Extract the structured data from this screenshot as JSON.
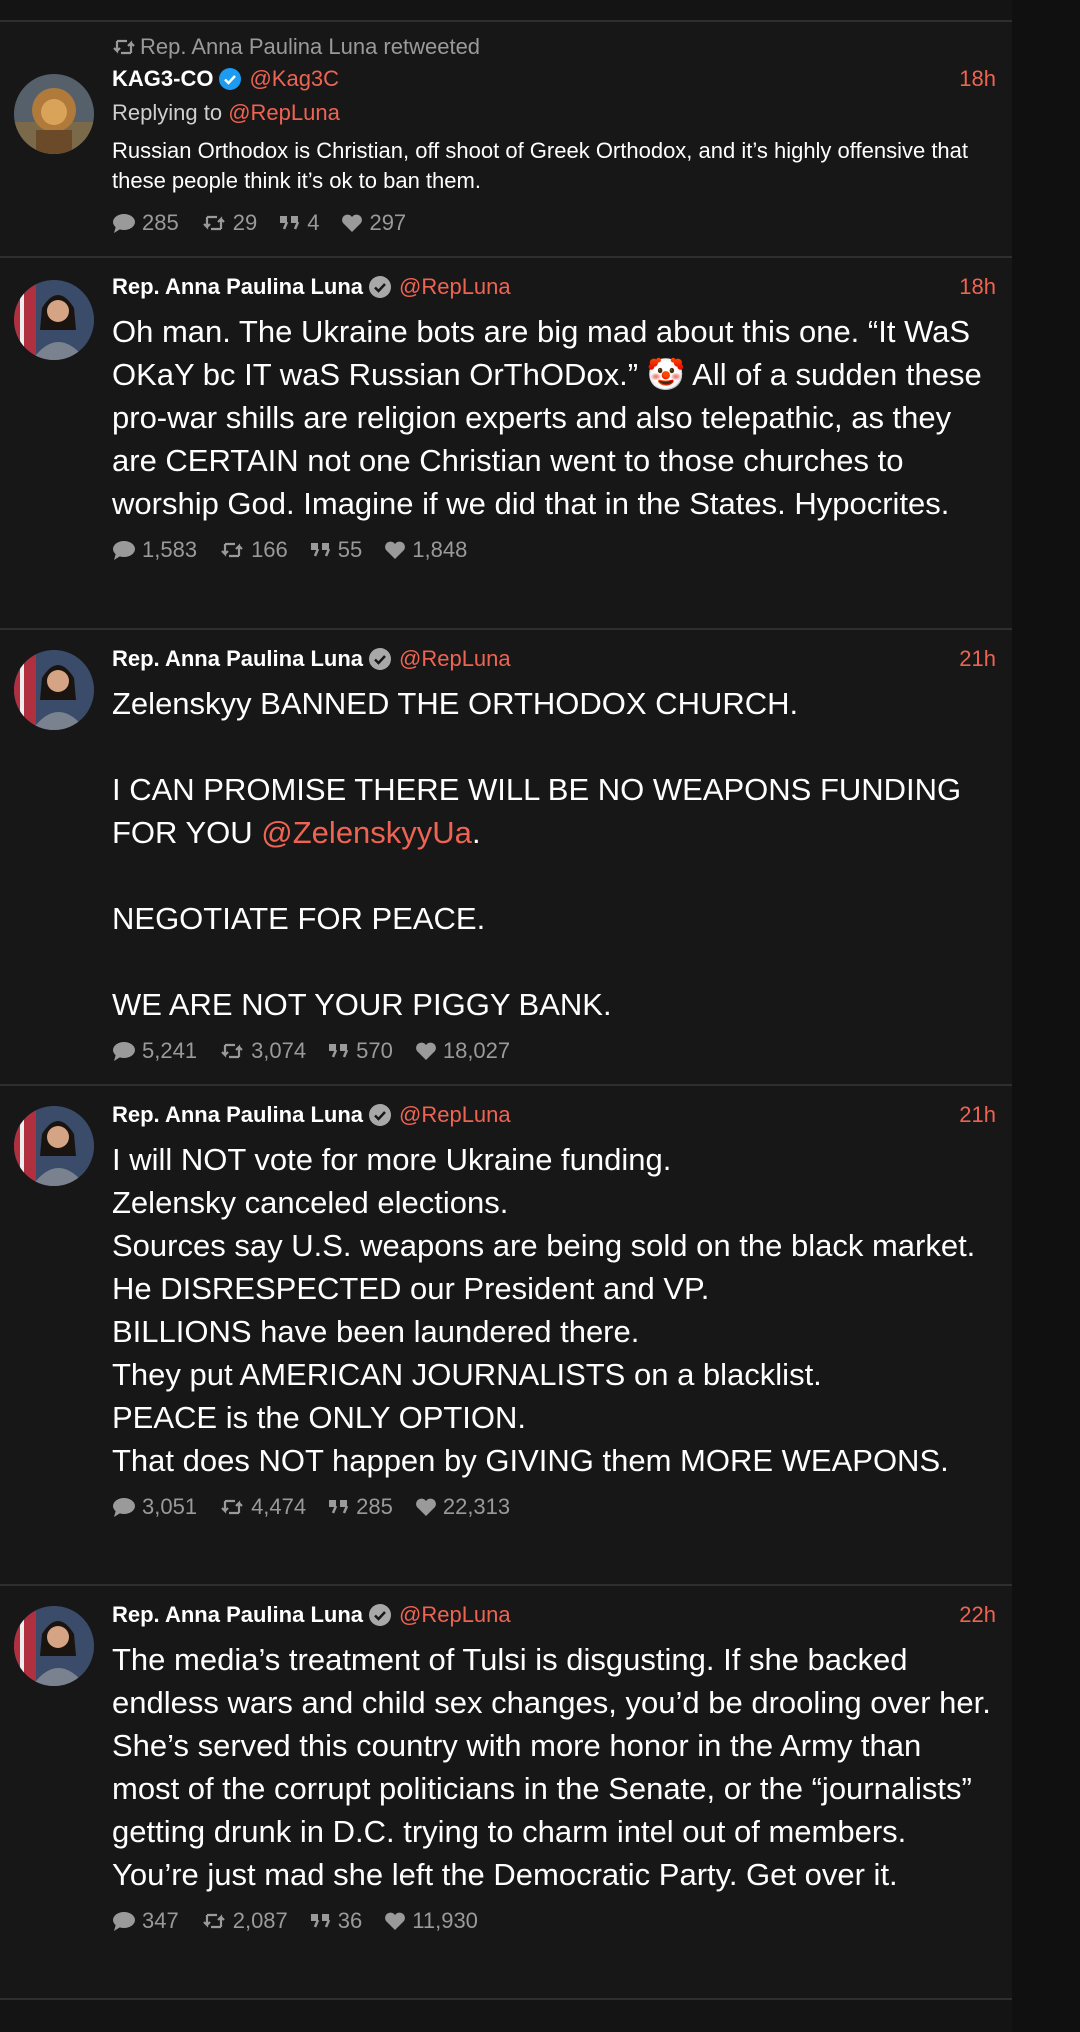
{
  "tweets": [
    {
      "retweeted_by": "Rep. Anna Paulina Luna retweeted",
      "name": "KAG3-CO",
      "handle": "@Kag3C",
      "time": "18h",
      "reply_prefix": "Replying to",
      "reply_to": "@RepLuna",
      "text": "Russian Orthodox is Christian, off shoot of Greek Orthodox, and it’s highly offensive that these people think it’s ok to ban them.",
      "stats": {
        "replies": "285",
        "retweets": "29",
        "quotes": "4",
        "likes": "297"
      }
    },
    {
      "name": "Rep. Anna Paulina Luna",
      "handle": "@RepLuna",
      "time": "18h",
      "text_before": "Oh man. The Ukraine bots are big mad about this one. “It WaS OKaY bc IT waS Russian OrThODox.” ",
      "emoji": "🤡",
      "text_after": " All of a sudden these pro-war shills are religion experts and also telepathic, as they are CERTAIN not one Christian went to those churches to worship God. Imagine if we did that in the States. Hypocrites.",
      "stats": {
        "replies": "1,583",
        "retweets": "166",
        "quotes": "55",
        "likes": "1,848"
      }
    },
    {
      "name": "Rep. Anna Paulina Luna",
      "handle": "@RepLuna",
      "time": "21h",
      "text_before": "Zelenskyy BANNED THE ORTHODOX CHURCH.\n\nI CAN PROMISE THERE WILL BE NO WEAPONS FUNDING FOR YOU ",
      "mention": "@ZelenskyyUa",
      "text_after": ".\n\nNEGOTIATE FOR PEACE.\n\nWE ARE NOT YOUR PIGGY BANK.",
      "stats": {
        "replies": "5,241",
        "retweets": "3,074",
        "quotes": "570",
        "likes": "18,027"
      }
    },
    {
      "name": "Rep. Anna Paulina Luna",
      "handle": "@RepLuna",
      "time": "21h",
      "text": "I will NOT vote for more Ukraine funding.\nZelensky canceled elections.\nSources say U.S. weapons are being sold on the black market.\nHe DISRESPECTED our President and VP.\nBILLIONS have been laundered there.\nThey put AMERICAN JOURNALISTS on a blacklist.\nPEACE is the ONLY OPTION.\nThat does NOT happen by GIVING them MORE WEAPONS.",
      "stats": {
        "replies": "3,051",
        "retweets": "4,474",
        "quotes": "285",
        "likes": "22,313"
      }
    },
    {
      "name": "Rep. Anna Paulina Luna",
      "handle": "@RepLuna",
      "time": "22h",
      "text": "The media’s treatment of Tulsi is disgusting. If she backed endless wars and child sex changes, you’d be drooling over her. She’s served this country with more honor in the Army than most of the corrupt politicians in the Senate, or the “journalists” getting drunk in D.C. trying to charm intel out of members. You’re just mad she left the Democratic Party. Get over it.",
      "stats": {
        "replies": "347",
        "retweets": "2,087",
        "quotes": "36",
        "likes": "11,930"
      }
    }
  ],
  "colors": {
    "accent": "#ef6352",
    "verified_blue": "#1d9bf0",
    "verified_gray": "#a8a8a8",
    "background": "#171717"
  },
  "icons": [
    "retweet-icon",
    "reply-icon",
    "quote-icon",
    "like-icon",
    "verified-badge-icon"
  ]
}
